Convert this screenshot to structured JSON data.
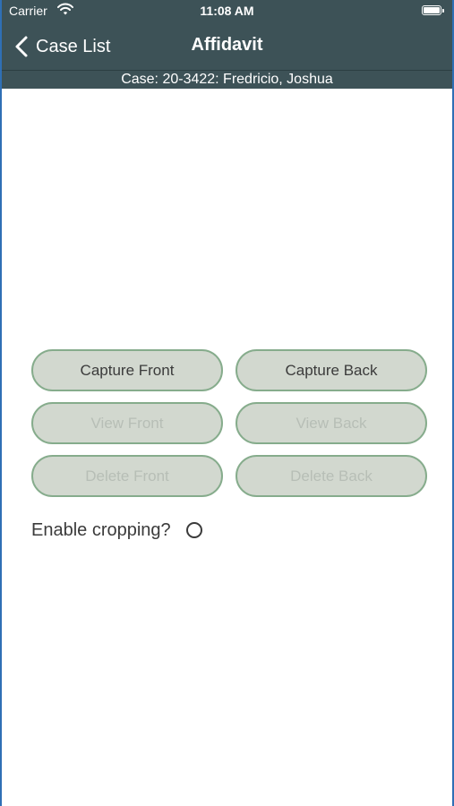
{
  "status_bar": {
    "carrier": "Carrier",
    "time": "11:08 AM"
  },
  "nav": {
    "back_label": "Case List",
    "title": "Affidavit"
  },
  "case": {
    "subtitle": "Case: 20-3422: Fredricio, Joshua"
  },
  "buttons": {
    "capture_front": "Capture Front",
    "capture_back": "Capture Back",
    "view_front": "View Front",
    "view_back": "View Back",
    "delete_front": "Delete Front",
    "delete_back": "Delete Back"
  },
  "cropping": {
    "label": "Enable cropping?",
    "enabled": false
  },
  "colors": {
    "header_bg": "#3d5257",
    "button_bg": "#d2d8cf",
    "button_border": "#86ac8c",
    "text_primary": "#3b3b3b",
    "text_disabled": "#b7beb6"
  },
  "icons": {
    "wifi": "wifi-icon",
    "battery": "battery-icon",
    "back": "chevron-left-icon",
    "radio": "radio-unchecked-icon"
  }
}
